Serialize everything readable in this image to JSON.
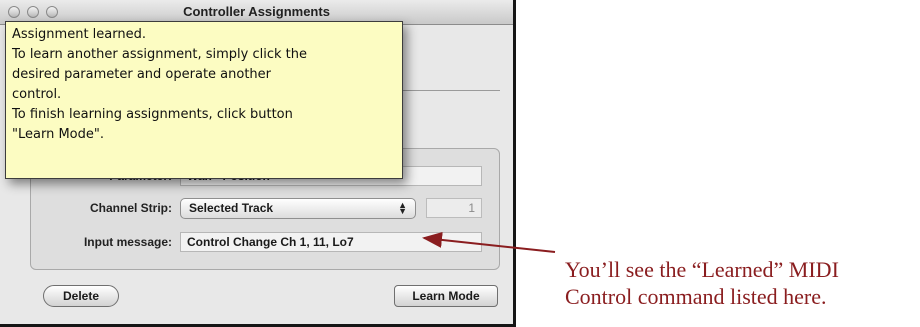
{
  "window": {
    "title": "Controller Assignments"
  },
  "tooltip": {
    "lines": [
      "Assignment learned.",
      "To learn another assignment, simply click the",
      "desired parameter and operate another",
      "control.",
      "To finish learning assignments, click button",
      "\"Learn Mode\"."
    ]
  },
  "form": {
    "parameter_label": "Parameter:",
    "parameter_value": "Wah - Position",
    "channel_strip_label": "Channel Strip:",
    "channel_strip_value": "Selected Track",
    "channel_number": "1",
    "input_message_label": "Input message:",
    "input_message_value": "Control Change Ch 1, 11, Lo7"
  },
  "buttons": {
    "delete_label": "Delete",
    "learn_mode_label": "Learn Mode"
  },
  "annotation": {
    "line1": "You’ll see the “Learned” MIDI",
    "line2": "Control command listed here.",
    "color": "#8a1d1f"
  }
}
